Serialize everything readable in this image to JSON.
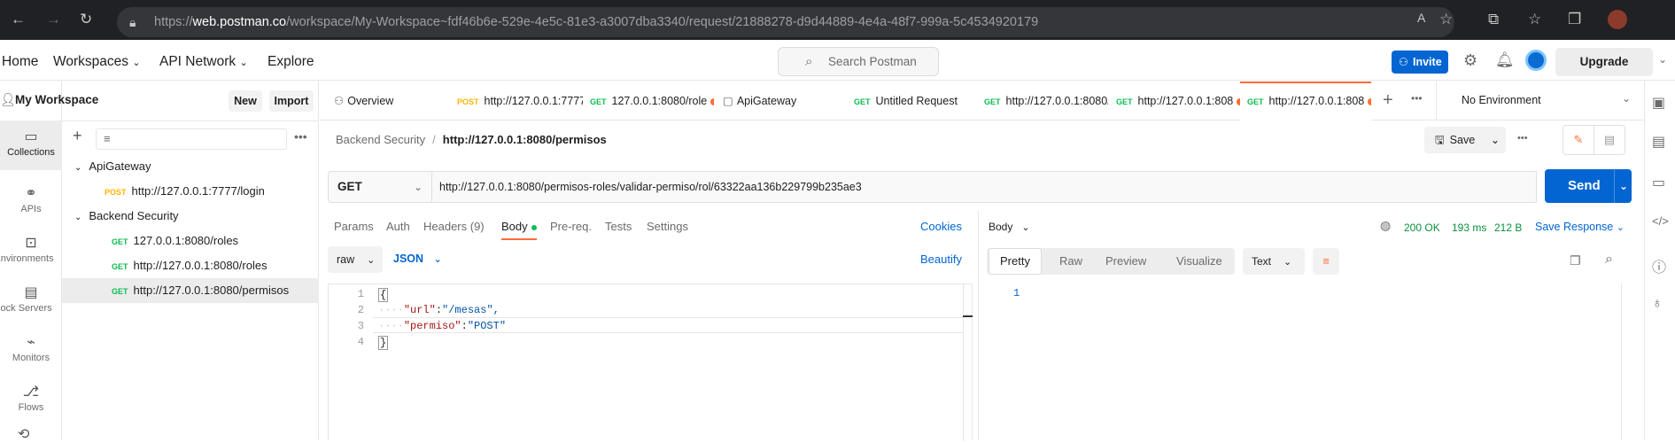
{
  "browser": {
    "url_prefix": "https://",
    "url_domain": "web.postman.co",
    "url_path": "/workspace/My-Workspace~fdf46b6e-529e-4e5c-81e3-a3007dba3340/request/21888278-d9d44889-4e4a-48f7-999a-5c4534920179"
  },
  "header": {
    "home": "Home",
    "workspaces": "Workspaces",
    "api_network": "API Network",
    "explore": "Explore",
    "search_placeholder": "Search Postman",
    "invite": "Invite",
    "upgrade": "Upgrade"
  },
  "rail": {
    "items": [
      {
        "label": "Collections",
        "icon": "collections-icon"
      },
      {
        "label": "APIs",
        "icon": "apis-icon"
      },
      {
        "label": "Environments",
        "icon": "environments-icon"
      },
      {
        "label": "Mock Servers",
        "icon": "mock-servers-icon"
      },
      {
        "label": "Monitors",
        "icon": "monitors-icon"
      },
      {
        "label": "Flows",
        "icon": "flows-icon"
      }
    ]
  },
  "sidebar": {
    "workspace": "My Workspace",
    "new_btn": "New",
    "import_btn": "Import",
    "collections": [
      {
        "name": "ApiGateway",
        "requests": [
          {
            "method": "POST",
            "url": "http://127.0.0.1:7777/login"
          }
        ]
      },
      {
        "name": "Backend Security",
        "requests": [
          {
            "method": "GET",
            "url": "127.0.0.1:8080/roles"
          },
          {
            "method": "GET",
            "url": "http://127.0.0.1:8080/roles"
          },
          {
            "method": "GET",
            "url": "http://127.0.0.1:8080/permisos"
          }
        ]
      }
    ]
  },
  "tabs": [
    {
      "method": "",
      "label": "Overview"
    },
    {
      "method": "POST",
      "label": "http://127.0.0.1:7777"
    },
    {
      "method": "GET",
      "label": "127.0.0.1:8080/role"
    },
    {
      "method": "",
      "label": "ApiGateway"
    },
    {
      "method": "GET",
      "label": "Untitled Request"
    },
    {
      "method": "GET",
      "label": "http://127.0.0.1:8080/"
    },
    {
      "method": "GET",
      "label": "http://127.0.0.1:808"
    },
    {
      "method": "GET",
      "label": "http://127.0.0.1:808"
    }
  ],
  "environment": "No Environment",
  "request": {
    "breadcrumb_parent": "Backend Security",
    "breadcrumb_sep": "/",
    "breadcrumb_current": "http://127.0.0.1:8080/permisos",
    "save": "Save",
    "method": "GET",
    "url": "http://127.0.0.1:8080/permisos-roles/validar-permiso/rol/63322aa136b229799b235ae3",
    "send": "Send",
    "subtabs": [
      "Params",
      "Auth",
      "Headers (9)",
      "Body",
      "Pre-req.",
      "Tests",
      "Settings"
    ],
    "cookies": "Cookies",
    "body_mode": "raw",
    "body_lang": "JSON",
    "beautify": "Beautify",
    "code_lines": [
      {
        "n": "1",
        "text": "{"
      },
      {
        "n": "2",
        "key": "\"url\"",
        "value": "\"/mesas\","
      },
      {
        "n": "3",
        "key": "\"permiso\"",
        "value": "\"POST\""
      },
      {
        "n": "4",
        "text": "}"
      }
    ]
  },
  "response": {
    "title": "Body",
    "status": "200 OK",
    "time": "193 ms",
    "size": "212 B",
    "save_response": "Save Response",
    "views": [
      "Pretty",
      "Raw",
      "Preview",
      "Visualize"
    ],
    "format": "Text",
    "line1": "1"
  }
}
